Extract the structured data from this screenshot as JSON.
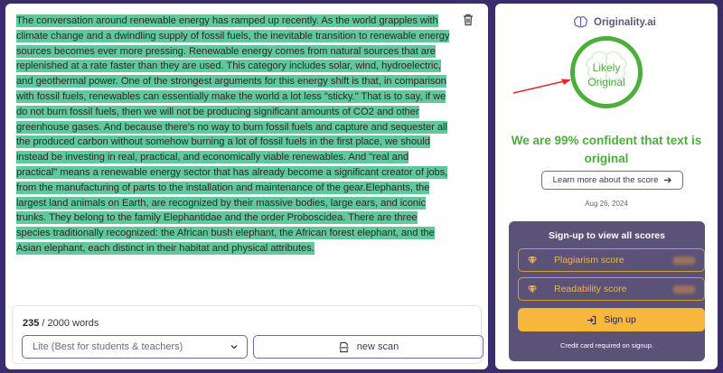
{
  "editor": {
    "text": "The conversation around renewable energy has ramped up recently. As the world grapples with climate change and a dwindling supply of fossil fuels, the inevitable transition to renewable energy sources becomes ever more pressing. Renewable energy comes from natural sources that are replenished at a rate faster than they are used. This category includes solar, wind, hydroelectric, and geothermal power. One of the strongest arguments for this energy shift is that, in comparison with fossil fuels, renewables can essentially make the world a lot less \"sticky.\" That is to say, if we do not burn fossil fuels, then we will not be producing significant amounts of CO2 and other greenhouse gases. And because there's no way to burn fossil fuels and capture and sequester all the produced carbon without somehow burning a lot of fossil fuels in the first place, we should instead be investing in real, practical, and economically viable renewables. And \"real and practical\" means a renewable energy sector that has already become a significant creator of jobs, from the manufacturing of parts to the installation and maintenance of the gear.Elephants, the largest land animals on Earth, are recognized by their massive bodies, large ears, and iconic trunks. They belong to the family Elephantidae and the order Proboscidea. There are three species traditionally recognized: the African bush elephant, the African forest elephant, and the Asian elephant, each distinct in their habitat and physical attributes.",
    "highlight_color": "#5fc99b",
    "word_count": "235",
    "word_limit": "/ 2000 words",
    "mode": "Lite (Best for students & teachers)",
    "new_scan": "new scan",
    "icons": [
      "trash-icon",
      "chevron-down-icon",
      "scan-icon"
    ]
  },
  "results": {
    "brand": "Originality.ai",
    "verdict_line1": "Likely",
    "verdict_line2": "Original",
    "verdict_color": "#4cae3b",
    "confidence": "We are 99% confident that text is original",
    "learn_more": "Learn more about the score",
    "date": "Aug 26, 2024",
    "signup": {
      "title": "Sign-up to view all scores",
      "plagiarism": "Plagiarism score",
      "readability": "Readability score",
      "button": "Sign up",
      "note": "Credit card required on signup."
    },
    "accent_color": "#f6b73c",
    "card_color": "#5b5277"
  }
}
